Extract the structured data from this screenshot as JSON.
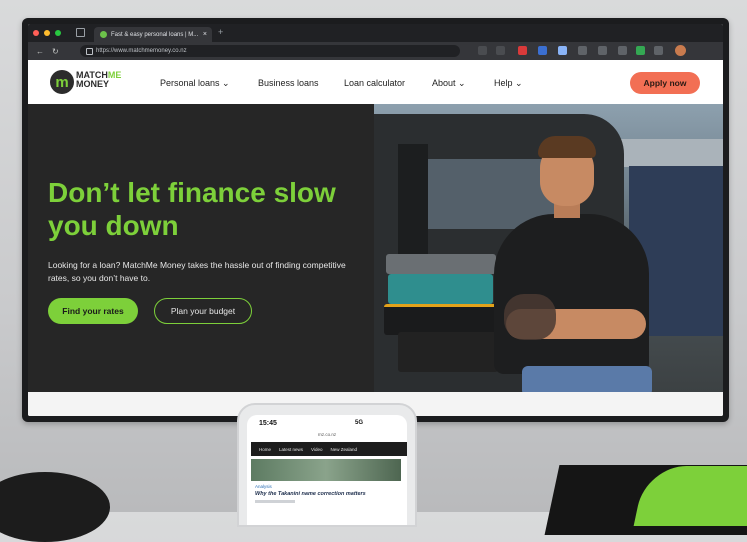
{
  "browser": {
    "tab_title": "Fast & easy personal loans | M...",
    "tab_close": "×",
    "new_tab": "+",
    "url": "https://www.matchmemoney.co.nz"
  },
  "site": {
    "logo": {
      "mark": "m",
      "line1_a": "MATCH",
      "line1_b": "ME",
      "line2": "MONEY"
    },
    "nav": [
      {
        "label": "Personal loans ⌄"
      },
      {
        "label": "Business loans"
      },
      {
        "label": "Loan calculator"
      },
      {
        "label": "About ⌄"
      },
      {
        "label": "Help ⌄"
      }
    ],
    "apply_label": "Apply now",
    "hero": {
      "title": "Don’t let finance slow you down",
      "subtitle": "Looking for a loan? MatchMe Money takes the hassle out of finding competitive rates, so you don’t have to.",
      "primary_cta": "Find your rates",
      "secondary_cta": "Plan your budget"
    }
  },
  "phone": {
    "time": "15:45",
    "signal": "5G",
    "url": "rnz.co.nz",
    "nav": [
      "Home",
      "Latest news",
      "Video",
      "New Zealand"
    ],
    "category": "Analysis",
    "headline": "Why the Takanini name correction matters"
  },
  "colors": {
    "brand_green": "#7dd03a",
    "apply_coral": "#f26f54",
    "hero_dark": "#262626"
  }
}
